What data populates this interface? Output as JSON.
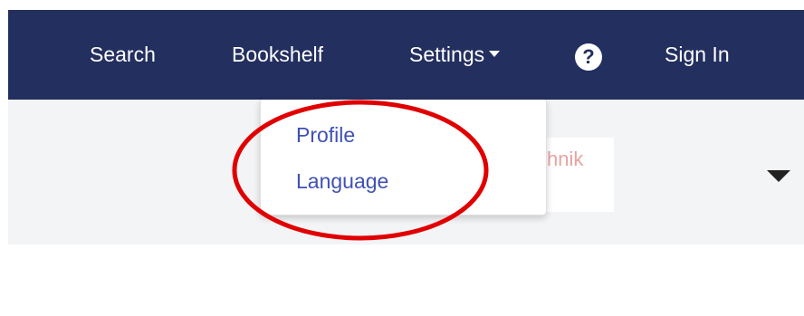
{
  "navbar": {
    "search_label": "Search",
    "bookshelf_label": "Bookshelf",
    "settings_label": "Settings",
    "help_icon_glyph": "?",
    "signin_label": "Sign In",
    "background_color": "#232f5f"
  },
  "settings_menu": {
    "items": [
      {
        "label": "Profile"
      },
      {
        "label": "Language"
      }
    ],
    "item_color": "#3f51b5"
  },
  "logo": {
    "partial_text": "chnik"
  },
  "annotation": {
    "shape": "ellipse",
    "color": "#e00000"
  }
}
